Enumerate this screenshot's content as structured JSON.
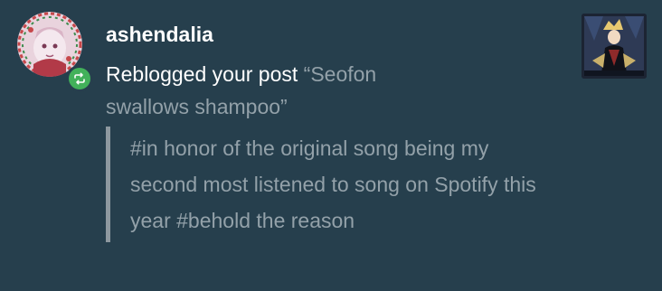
{
  "notification": {
    "username": "ashendalia",
    "action_prefix": "Reblogged your post",
    "post_title": "“Seofon swallows shampoo”",
    "tags": [
      "#in honor of the original song being my second most listened to song on Spotify this year",
      "#behold the reason"
    ],
    "icons": {
      "badge": "reblog-icon"
    },
    "colors": {
      "background": "#263f4d",
      "reblog_badge": "#42b15a",
      "secondary_text": "#93a1a9",
      "tag_border": "#8d989f"
    }
  }
}
